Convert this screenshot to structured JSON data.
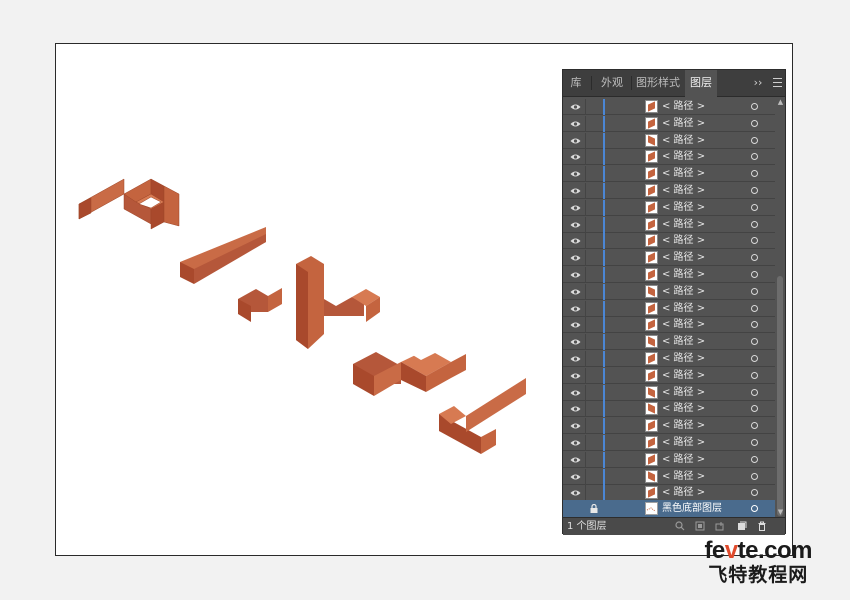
{
  "panel": {
    "tabs": [
      {
        "label": "库"
      },
      {
        "label": "外观"
      },
      {
        "label": "图形样式"
      },
      {
        "label": "图层"
      }
    ],
    "more_label": "››",
    "path_label": "< 路径 >",
    "paths": [
      {
        "label": "< 路径 >"
      },
      {
        "label": "< 路径 >"
      },
      {
        "label": "< 路径 >"
      },
      {
        "label": "< 路径 >"
      },
      {
        "label": "< 路径 >"
      },
      {
        "label": "< 路径 >"
      },
      {
        "label": "< 路径 >"
      },
      {
        "label": "< 路径 >"
      },
      {
        "label": "< 路径 >"
      },
      {
        "label": "< 路径 >"
      },
      {
        "label": "< 路径 >"
      },
      {
        "label": "< 路径 >"
      },
      {
        "label": "< 路径 >"
      },
      {
        "label": "< 路径 >"
      },
      {
        "label": "< 路径 >"
      },
      {
        "label": "< 路径 >"
      },
      {
        "label": "< 路径 >"
      },
      {
        "label": "< 路径 >"
      },
      {
        "label": "< 路径 >"
      },
      {
        "label": "< 路径 >"
      },
      {
        "label": "< 路径 >"
      },
      {
        "label": "< 路径 >"
      },
      {
        "label": "< 路径 >"
      },
      {
        "label": "< 路径 >"
      }
    ],
    "layer_label": "黑色底部图层",
    "footer_text": "1 个图层"
  },
  "watermark": {
    "line1_a": "fe",
    "line1_v": "v",
    "line1_b": "te.com",
    "line2": "飞特教程网"
  },
  "colors": {
    "artwork_top": "#c4643f",
    "artwork_side": "#a9492c",
    "selection": "#4a6b8d",
    "layer_bar": "#4b86d4"
  }
}
